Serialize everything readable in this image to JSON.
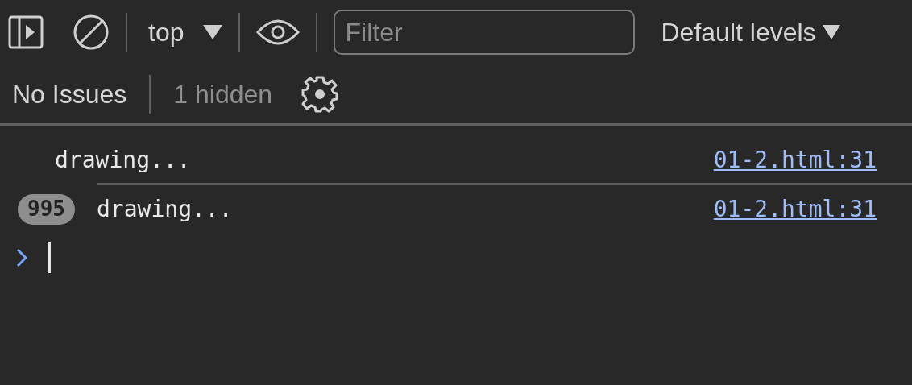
{
  "toolbar": {
    "context": "top",
    "filter": {
      "placeholder": "Filter"
    },
    "levels": "Default levels"
  },
  "issues": {
    "status": "No Issues",
    "hidden": "1 hidden"
  },
  "messages": [
    {
      "text": "drawing...",
      "source": "01-2.html:31"
    },
    {
      "count": "995",
      "text": "drawing...",
      "source": "01-2.html:31"
    }
  ]
}
